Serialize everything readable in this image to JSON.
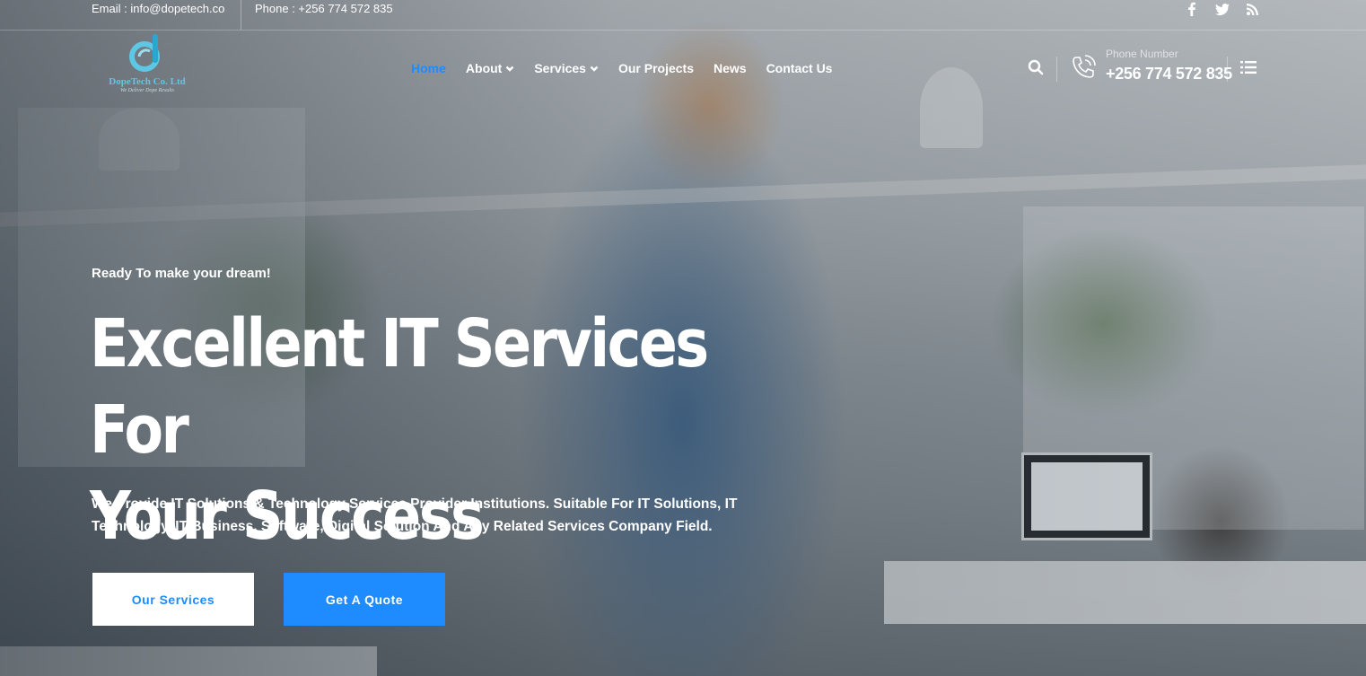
{
  "topbar": {
    "email": "Email : info@dopetech.co",
    "phone": "Phone : +256 774 572 835"
  },
  "logo": {
    "name": "DopeTech Co. Ltd",
    "tagline": "We Deliver Dope Results"
  },
  "nav": {
    "items": [
      {
        "label": "Home",
        "active": true
      },
      {
        "label": "About",
        "dropdown": true
      },
      {
        "label": "Services",
        "dropdown": true
      },
      {
        "label": "Our Projects"
      },
      {
        "label": "News"
      },
      {
        "label": "Contact Us"
      }
    ]
  },
  "header": {
    "phone_label": "Phone Number",
    "phone_number": "+256 774 572 835"
  },
  "hero": {
    "eyebrow": "Ready To make your dream!",
    "headline_line1": "Excellent IT Services For",
    "headline_line2": "Your Success",
    "subtext": "We Provide IT Solutions & Technology Services Provider Institutions. Suitable For IT Solutions, IT Technology, IT Business, Software, Digital Solution And Any Related Services Company Field.",
    "primary_button": "Our Services",
    "secondary_button": "Get A Quote"
  },
  "icons": {
    "social": [
      "facebook-icon",
      "twitter-icon",
      "rss-icon"
    ],
    "header": [
      "search-icon",
      "phone-icon",
      "menu-list-icon"
    ]
  },
  "colors": {
    "accent": "#1e8cff",
    "logo": "#5ec8e4",
    "text": "#ffffff"
  }
}
